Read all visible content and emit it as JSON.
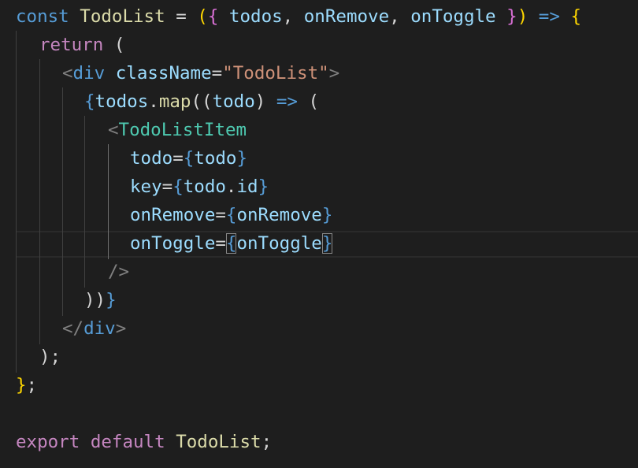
{
  "code": {
    "l1": {
      "kw_const": "const",
      "fn_name": "TodoList",
      "eq": " = ",
      "paren_open": "(",
      "brace_open": "{",
      "param_todos": " todos",
      "comma1": ", ",
      "param_onRemove": "onRemove",
      "comma2": ", ",
      "param_onToggle": "onToggle",
      "brace_close": " }",
      "paren_close": ")",
      "arrow": " => ",
      "body_open": "{"
    },
    "l2": {
      "kw_return": "return",
      "paren": " ("
    },
    "l3": {
      "lt": "<",
      "tag": "div",
      "attr": " className",
      "eq": "=",
      "str": "\"TodoList\"",
      "gt": ">"
    },
    "l4": {
      "brace": "{",
      "obj": "todos",
      "dot": ".",
      "method": "map",
      "paren1": "(",
      "paren2": "(",
      "arg": "todo",
      "paren3": ")",
      "arrow": " => ",
      "paren4": "("
    },
    "l5": {
      "lt": "<",
      "component": "TodoListItem"
    },
    "l6": {
      "attr": "todo",
      "eq": "=",
      "open": "{",
      "val": "todo",
      "close": "}"
    },
    "l7": {
      "attr": "key",
      "eq": "=",
      "open": "{",
      "obj": "todo",
      "dot": ".",
      "prop": "id",
      "close": "}"
    },
    "l8": {
      "attr": "onRemove",
      "eq": "=",
      "open": "{",
      "val": "onRemove",
      "close": "}"
    },
    "l9": {
      "attr": "onToggle",
      "eq": "=",
      "open": "{",
      "val": "onToggle",
      "close": "}"
    },
    "l10": {
      "close": "/>"
    },
    "l11": {
      "paren1": ")",
      "paren2": ")",
      "brace": "}"
    },
    "l12": {
      "lt": "</",
      "tag": "div",
      "gt": ">"
    },
    "l13": {
      "paren": ")",
      "semi": ";"
    },
    "l14": {
      "brace": "}",
      "semi": ";"
    },
    "l16": {
      "kw_export": "export",
      "kw_default": " default",
      "name": " TodoList",
      "semi": ";"
    }
  },
  "colors": {
    "background": "#1e1e1e",
    "keyword": "#569cd6",
    "control_keyword": "#c586c0",
    "function": "#dcdcaa",
    "variable": "#9cdcfe",
    "component": "#4ec9b0",
    "string": "#ce9178",
    "bracket_level1": "#ffd700",
    "bracket_level2": "#da70d6",
    "bracket_level3": "#179fff"
  }
}
